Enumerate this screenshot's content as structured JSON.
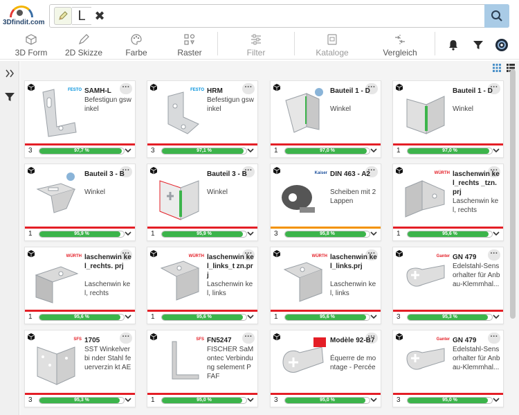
{
  "app": {
    "logo_text": "3Dfindit.com"
  },
  "search": {
    "stroke_symbol": "L",
    "clear_symbol": "✖"
  },
  "toolbar": {
    "items": [
      {
        "label": "3D Form",
        "icon": "cube-outline-icon",
        "enabled": true
      },
      {
        "label": "2D Skizze",
        "icon": "sketch-icon",
        "enabled": true
      },
      {
        "label": "Farbe",
        "icon": "palette-icon",
        "enabled": true
      },
      {
        "label": "Raster",
        "icon": "raster-icon",
        "enabled": true
      },
      {
        "label": "Filter",
        "icon": "sliders-icon",
        "enabled": false
      },
      {
        "label": "Kataloge",
        "icon": "catalog-icon",
        "enabled": false
      },
      {
        "label": "Vergleich",
        "icon": "compare-icon",
        "enabled": true
      }
    ],
    "right_icons": [
      "bell-icon",
      "filter-funnel-icon",
      "user-avatar-icon"
    ]
  },
  "colors": {
    "accent_blue": "#a9cbe6",
    "match_green": "#3cb44b",
    "catalog_red": "#e41e26",
    "catalog_orange": "#f39200"
  },
  "results": [
    {
      "title": "SAMH-L",
      "desc": "Befestigun gswinkel",
      "count": "3",
      "match": "97,7 %",
      "pct": 0.977,
      "vendor": "FESTO"
    },
    {
      "title": "HRM",
      "desc": "Befestigun gswinkel",
      "count": "3",
      "match": "97,1 %",
      "pct": 0.971,
      "vendor": "FESTO"
    },
    {
      "title": "Bauteil 1 - D",
      "desc": "Winkel",
      "count": "1",
      "match": "97,0 %",
      "pct": 0.97,
      "vendor": ""
    },
    {
      "title": "Bauteil 1 - D",
      "desc": "Winkel",
      "count": "1",
      "match": "97,0 %",
      "pct": 0.97,
      "vendor": ""
    },
    {
      "title": "Bauteil 3 - B",
      "desc": "Winkel",
      "count": "1",
      "match": "95,9 %",
      "pct": 0.959,
      "vendor": ""
    },
    {
      "title": "Bauteil 3 - B",
      "desc": "Winkel",
      "count": "1",
      "match": "95,9 %",
      "pct": 0.959,
      "vendor": ""
    },
    {
      "title": "DIN 463 - A2",
      "desc": "Scheiben mit 2 Lappen",
      "count": "3",
      "match": "95,8 %",
      "pct": 0.958,
      "vendor": "Kaiser"
    },
    {
      "title": "laschenwin kel_rechts _tzn.prj",
      "desc": "Laschenwin kel, rechts",
      "count": "1",
      "match": "95,6 %",
      "pct": 0.956,
      "vendor": "WÜRTH"
    },
    {
      "title": "laschenwin kel_rechts. prj",
      "desc": "Laschenwin kel, rechts",
      "count": "1",
      "match": "95,6 %",
      "pct": 0.956,
      "vendor": "WÜRTH"
    },
    {
      "title": "laschenwin kel_links_t zn.prj",
      "desc": "Laschenwin kel, links",
      "count": "1",
      "match": "95,6 %",
      "pct": 0.956,
      "vendor": "WÜRTH"
    },
    {
      "title": "laschenwin kel_links.prj",
      "desc": "Laschenwin kel, links",
      "count": "1",
      "match": "95,6 %",
      "pct": 0.956,
      "vendor": "WÜRTH"
    },
    {
      "title": "GN 479",
      "desc": "Edelstahl-Sensorhalter für Anbau-Klemmhal...",
      "count": "3",
      "match": "95,3 %",
      "pct": 0.953,
      "vendor": "Ganter"
    },
    {
      "title": "1705",
      "desc": "SST Winkelverbi nder Stahl feuerverzin kt AE",
      "count": "3",
      "match": "95,3 %",
      "pct": 0.953,
      "vendor": "SFS"
    },
    {
      "title": "FN5247",
      "desc": "FISCHER SaMontec Verbindung selement PFAF",
      "count": "1",
      "match": "95,0 %",
      "pct": 0.95,
      "vendor": "SFS"
    },
    {
      "title": "Modèle 92-B7",
      "desc": "Équerre de montage - Percée",
      "count": "3",
      "match": "95,0 %",
      "pct": 0.95,
      "vendor": ""
    },
    {
      "title": "GN 479",
      "desc": "Edelstahl-Sensorhalter für Anbau-Klemmhal...",
      "count": "3",
      "match": "95,0 %",
      "pct": 0.95,
      "vendor": "Ganter"
    }
  ]
}
